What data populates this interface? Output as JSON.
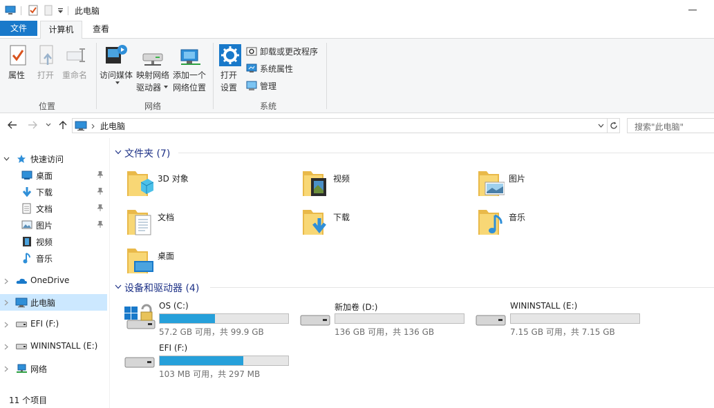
{
  "window": {
    "title": "此电脑"
  },
  "tabs": {
    "file": "文件",
    "computer": "计算机",
    "view": "查看"
  },
  "ribbon": {
    "location": {
      "group_label": "位置",
      "properties": "属性",
      "open": "打开",
      "rename": "重命名"
    },
    "network": {
      "group_label": "网络",
      "access_media": "访问媒体",
      "map_drive_1": "映射网络",
      "map_drive_2": "驱动器",
      "add_location_1": "添加一个",
      "add_location_2": "网络位置"
    },
    "system": {
      "group_label": "系统",
      "open_settings_1": "打开",
      "open_settings_2": "设置",
      "uninstall": "卸载或更改程序",
      "system_properties": "系统属性",
      "manage": "管理"
    }
  },
  "address": {
    "path": "此电脑",
    "search_placeholder": "搜索\"此电脑\""
  },
  "nav": {
    "quick_access": "快速访问",
    "items": [
      "桌面",
      "下载",
      "文档",
      "图片",
      "视频",
      "音乐"
    ],
    "onedrive": "OneDrive",
    "this_pc": "此电脑",
    "efi": "EFI (F:)",
    "wininstall": "WININSTALL (E:)",
    "network": "网络"
  },
  "content": {
    "folders_header": "文件夹 (7)",
    "folders": [
      "3D 对象",
      "视频",
      "图片",
      "文档",
      "下载",
      "音乐",
      "桌面"
    ],
    "drives_header": "设备和驱动器 (4)",
    "drives": [
      {
        "name": "OS (C:)",
        "info": "57.2 GB 可用，共 99.9 GB",
        "used_fraction": 0.43
      },
      {
        "name": "新加卷 (D:)",
        "info": "136 GB 可用，共 136 GB",
        "used_fraction": 0.0
      },
      {
        "name": "WININSTALL (E:)",
        "info": "7.15 GB 可用，共 7.15 GB",
        "used_fraction": 0.0
      },
      {
        "name": "EFI (F:)",
        "info": "103 MB 可用，共 297 MB",
        "used_fraction": 0.65
      }
    ]
  },
  "status": {
    "count": "11 个项目"
  },
  "colors": {
    "accent": "#1979ca",
    "selection": "#cce8ff",
    "drive_fill": "#26a0da",
    "folder": "#f8d775"
  }
}
